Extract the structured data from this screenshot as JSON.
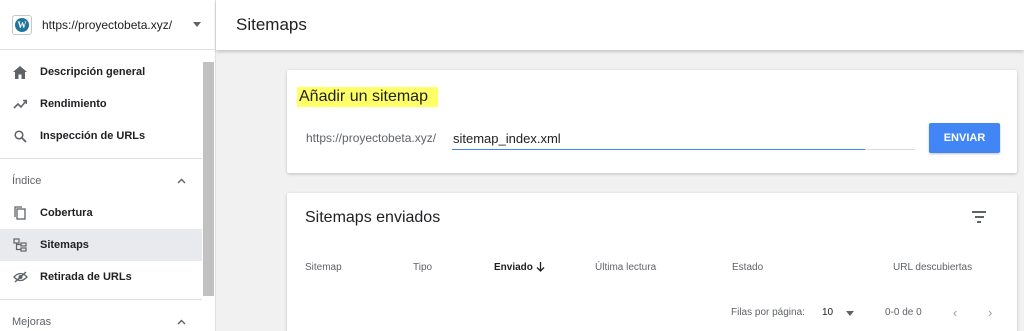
{
  "sidebar": {
    "property_url": "https://proyectobeta.xyz/",
    "items_top": [
      {
        "label": "Descripción general",
        "icon": "home-icon"
      },
      {
        "label": "Rendimiento",
        "icon": "trending-icon"
      },
      {
        "label": "Inspección de URLs",
        "icon": "search-icon"
      }
    ],
    "section_index": "Índice",
    "items_index": [
      {
        "label": "Cobertura",
        "icon": "copy-icon"
      },
      {
        "label": "Sitemaps",
        "icon": "sitemap-icon"
      },
      {
        "label": "Retirada de URLs",
        "icon": "eye-off-icon"
      }
    ],
    "section_improvements": "Mejoras"
  },
  "header": {
    "title": "Sitemaps"
  },
  "add_sitemap": {
    "title": "Añadir un sitemap",
    "prefix": "https://proyectobeta.xyz/",
    "input_value": "sitemap_index.xml",
    "submit_label": "ENVIAR"
  },
  "submitted": {
    "title": "Sitemaps enviados",
    "columns": [
      "Sitemap",
      "Tipo",
      "Enviado",
      "Última lectura",
      "Estado",
      "URL descubiertas"
    ],
    "rows_per_page_label": "Filas por página:",
    "rows_per_page": "10",
    "range": "0-0 de 0"
  },
  "colors": {
    "accent": "#4285f4",
    "highlight": "#ffff66"
  }
}
